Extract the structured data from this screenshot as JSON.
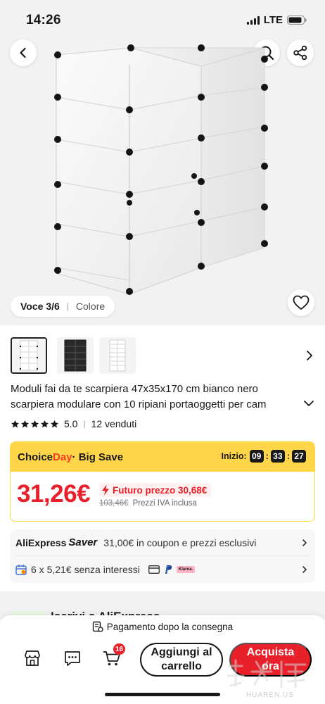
{
  "status_bar": {
    "time": "14:26",
    "network": "LTE"
  },
  "gallery": {
    "variant_label": "Voce 3/6",
    "color_label": "Colore"
  },
  "thumbnails": [
    {
      "name": "thumb-white",
      "selected": true
    },
    {
      "name": "thumb-black",
      "selected": false
    },
    {
      "name": "thumb-tall-white",
      "selected": false
    }
  ],
  "product": {
    "title_line1": "Moduli fai da te scarpiera 47x35x170 cm bianco nero",
    "title_line2": "scarpiera modulare con 10 ripiani portaoggetti per cam",
    "rating": "5.0",
    "sold": "12 venduti"
  },
  "deal": {
    "choice": "Choice",
    "day": "Day",
    "big_save": " · Big Save",
    "start_label": "Inizio:",
    "timer": {
      "hh": "09",
      "mm": "33",
      "ss": "27"
    },
    "price": "31,26€",
    "future_price": "Futuro prezzo 30,68€",
    "old_price": "103,46€",
    "vat_note": "Prezzi IVA inclusa"
  },
  "saver": {
    "brand": "AliExpress",
    "brand_suffix": "Saver",
    "coupon_text": "31,00€ in coupon e prezzi esclusivi",
    "installments_text": "6 x 5,21€ senza interessi",
    "klarna": "Klarna."
  },
  "peek": {
    "text": "Iscrivi a AliExpress"
  },
  "bottom_bar": {
    "pay_after": "Pagamento dopo la consegna",
    "cart_count": "16",
    "add_to_cart": "Aggiungi al carrello",
    "buy_now": "Acquista ora"
  },
  "colors": {
    "accent_red": "#e7202a",
    "choice_yellow": "#ffd64a",
    "hero_bg": "#f2f2f2"
  },
  "icons": [
    "back-icon",
    "search-icon",
    "share-icon",
    "heart-icon",
    "chevron-right-icon",
    "chevron-down-icon",
    "star-icon",
    "lightning-icon",
    "calendar-icon",
    "card-icon",
    "paypal-icon",
    "store-icon",
    "chat-icon",
    "cart-icon",
    "delivery-icon"
  ]
}
